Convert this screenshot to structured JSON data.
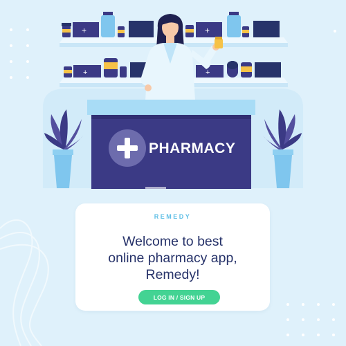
{
  "colors": {
    "background": "#dff1fb",
    "counter": "#3b3a85",
    "counter_top": "#a8dcf6",
    "accent": "#43d393",
    "brand_text": "#5fbfe6",
    "headline": "#27336a"
  },
  "illustration": {
    "counter_sign": "PHARMACY",
    "cross_icon": "plus-cross-icon"
  },
  "card": {
    "brand": "REMEDY",
    "headline": [
      "Welcome to best",
      "online pharmacy app,",
      "Remedy!"
    ],
    "cta_label": "LOG IN / SIGN UP"
  }
}
